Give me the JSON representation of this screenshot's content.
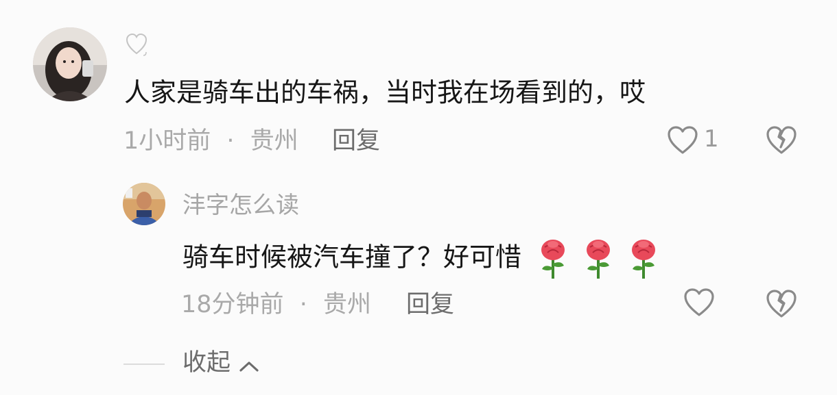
{
  "comment": {
    "text": "人家是骑车出的车祸，当时我在场看到的，哎",
    "time": "1小时前",
    "dot": "·",
    "location": "贵州",
    "reply_label": "回复",
    "like_count": "1"
  },
  "reply": {
    "username": "沣字怎么读",
    "text": "骑车时候被汽车撞了？好可惜",
    "time": "18分钟前",
    "dot": "·",
    "location": "贵州",
    "reply_label": "回复"
  },
  "collapse_label": "收起",
  "colors": {
    "background": "#fbfbfb",
    "text": "#161616",
    "meta": "#a9a9a9",
    "reply_link": "#6c6c6c",
    "icon": "#8a8a8a",
    "rose": "#e8495a"
  }
}
